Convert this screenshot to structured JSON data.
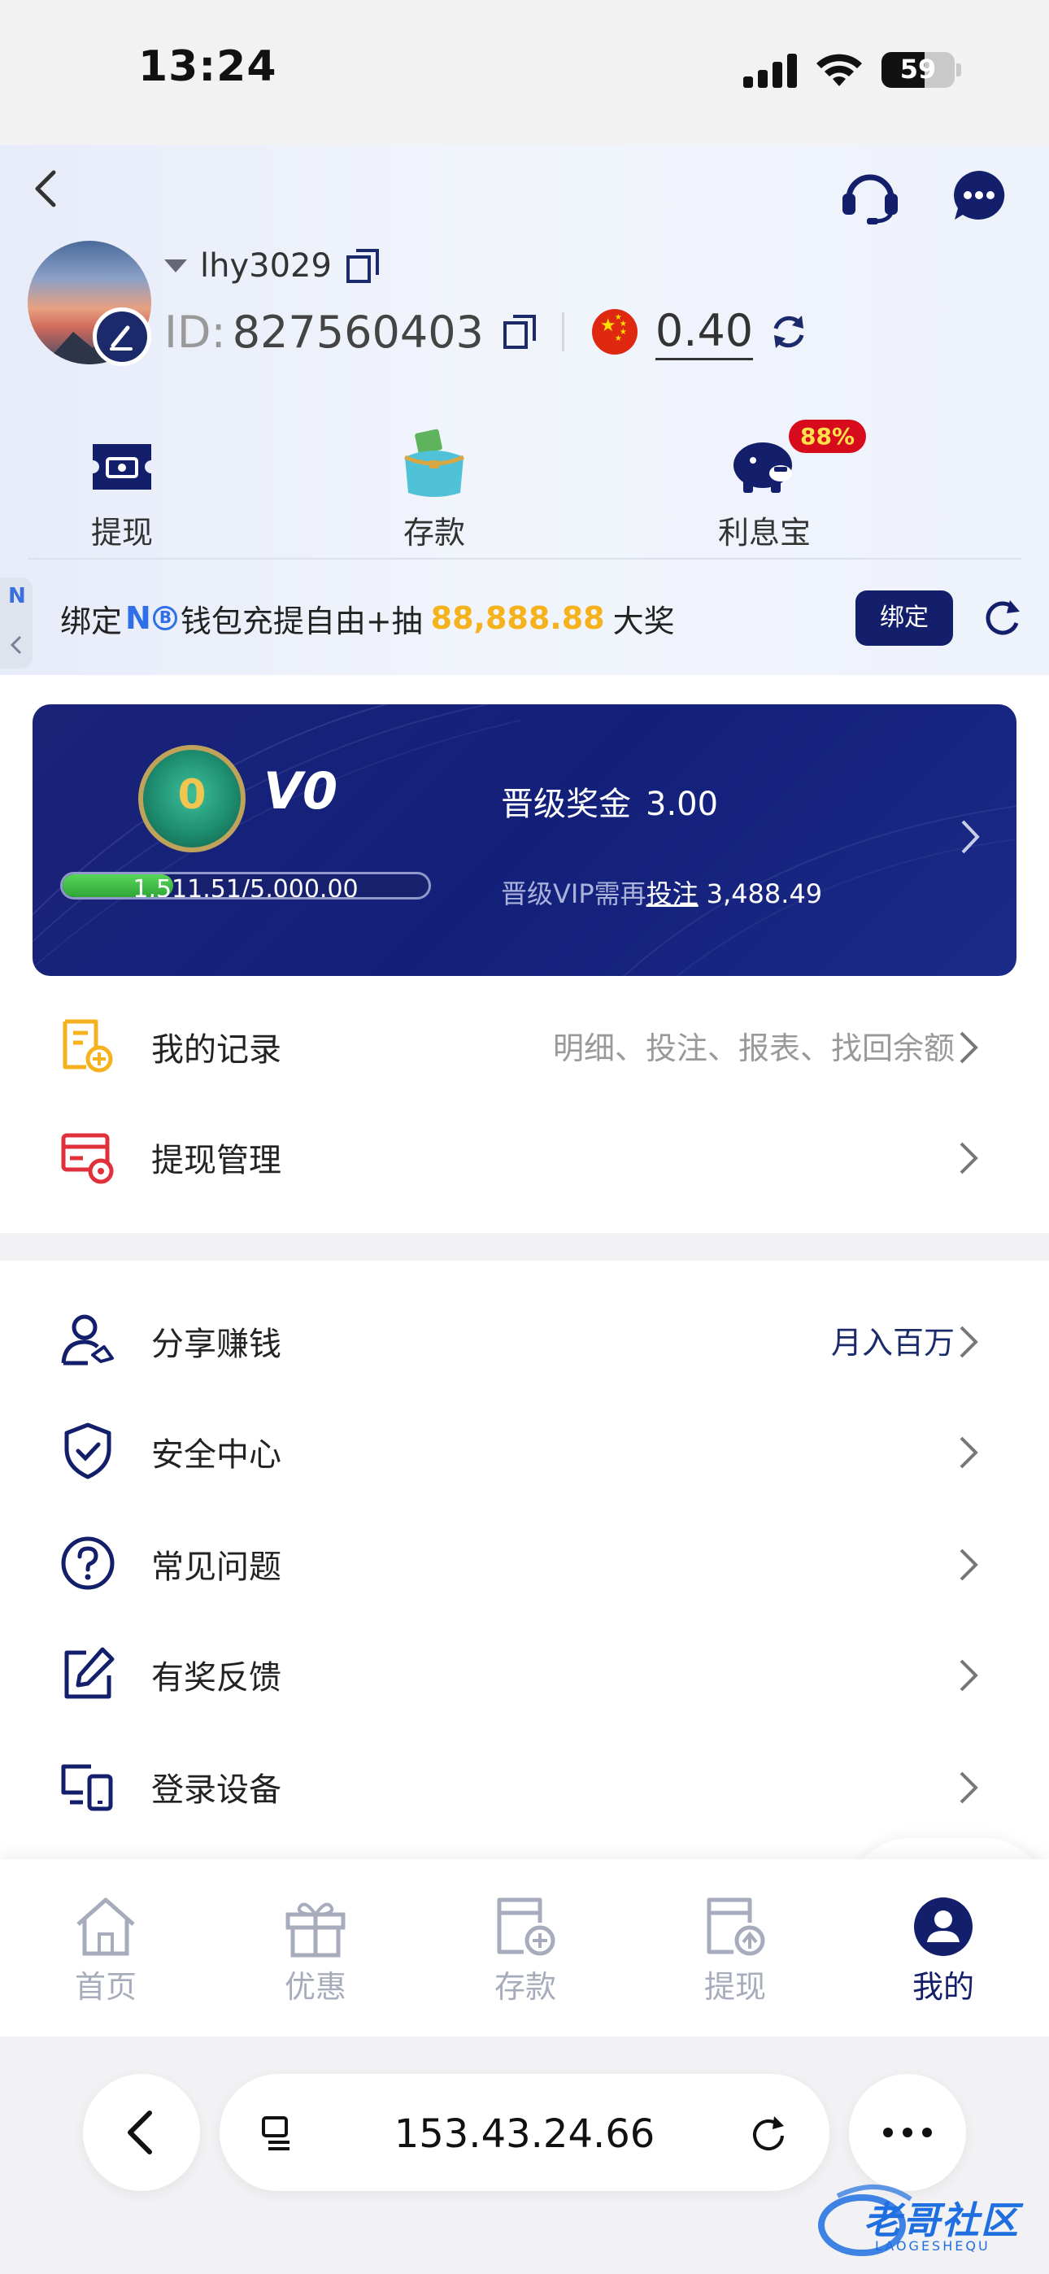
{
  "status_bar": {
    "time": "13:24",
    "battery": "59",
    "battery_level": 0.59
  },
  "header": {
    "username": "lhy3029",
    "id_label": "ID:",
    "id_value": "827560403",
    "balance": "0.40",
    "quick_actions": [
      {
        "label": "提现",
        "icon": "withdraw-ticket-icon"
      },
      {
        "label": "存款",
        "icon": "deposit-wallet-icon"
      },
      {
        "label": "利息宝",
        "icon": "piggy-bank-icon",
        "badge": "88%"
      }
    ]
  },
  "promo": {
    "side_tab": "N",
    "prefix": "绑定",
    "brand": "N",
    "middle": "钱包充提自由+抽",
    "amount": "88,888.88",
    "suffix": "大奖",
    "bind_button": "绑定"
  },
  "vip": {
    "medal_number": "0",
    "level": "V0",
    "progress_text": "1,511.51/5,000.00",
    "progress_fraction": 0.302,
    "bonus_label": "晋级奖金",
    "bonus_value": "3.00",
    "need_prefix": "晋级VIP需再",
    "need_link": "投注",
    "need_value": "3,488.49"
  },
  "menu_group_1": [
    {
      "label": "我的记录",
      "extra": "明细、投注、报表、找回余额",
      "icon": "records-icon"
    },
    {
      "label": "提现管理",
      "extra": "",
      "icon": "withdraw-settings-icon"
    }
  ],
  "menu_group_2": [
    {
      "label": "分享赚钱",
      "extra": "月入百万",
      "icon": "share-user-icon"
    },
    {
      "label": "安全中心",
      "extra": "",
      "icon": "shield-check-icon"
    },
    {
      "label": "常见问题",
      "extra": "",
      "icon": "question-circle-icon"
    },
    {
      "label": "有奖反馈",
      "extra": "",
      "icon": "feedback-edit-icon"
    },
    {
      "label": "登录设备",
      "extra": "",
      "icon": "devices-icon"
    }
  ],
  "tabbar": [
    {
      "label": "首页",
      "icon": "home-icon",
      "active": false
    },
    {
      "label": "优惠",
      "icon": "gift-icon",
      "active": false
    },
    {
      "label": "存款",
      "icon": "deposit-card-icon",
      "active": false
    },
    {
      "label": "提现",
      "icon": "withdraw-card-icon",
      "active": false
    },
    {
      "label": "我的",
      "icon": "profile-icon",
      "active": true
    }
  ],
  "browser": {
    "url": "153.43.24.66"
  },
  "watermark": {
    "text": "老哥社区",
    "sub": "LAOGESHEQU"
  },
  "colors": {
    "navy": "#131f6b",
    "gold": "#f5b21c",
    "badge_red": "#d70b1c",
    "gray_text": "#999999"
  }
}
